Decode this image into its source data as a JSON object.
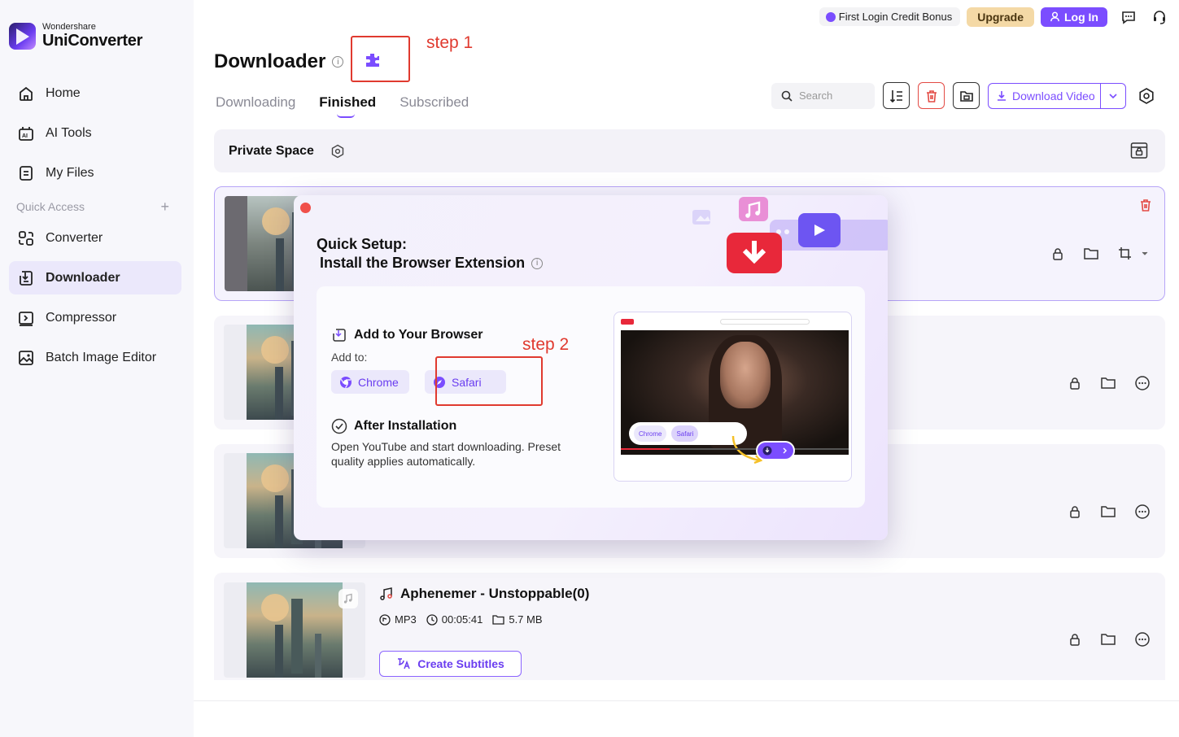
{
  "brand": {
    "line1": "Wondershare",
    "line2": "UniConverter"
  },
  "sidebar": {
    "items": [
      {
        "label": "Home",
        "icon": "home-icon"
      },
      {
        "label": "AI Tools",
        "icon": "ai-tools-icon"
      },
      {
        "label": "My Files",
        "icon": "my-files-icon"
      }
    ],
    "quick_access": {
      "label": "Quick Access",
      "add": "+"
    },
    "quick_items": [
      {
        "label": "Converter",
        "icon": "converter-icon"
      },
      {
        "label": "Downloader",
        "icon": "downloader-icon",
        "active": true
      },
      {
        "label": "Compressor",
        "icon": "compressor-icon"
      },
      {
        "label": "Batch Image Editor",
        "icon": "batch-image-editor-icon"
      }
    ]
  },
  "topbar": {
    "credit": "First Login Credit Bonus",
    "upgrade": "Upgrade",
    "login": "Log In"
  },
  "header": {
    "title": "Downloader",
    "info": "i",
    "tabs": [
      "Downloading",
      "Finished",
      "Subscribed"
    ],
    "active_tab": "Finished",
    "search_placeholder": "Search",
    "download_video": "Download Video"
  },
  "annotations": {
    "step1": "step 1",
    "step2": "step 2"
  },
  "private_space": {
    "label": "Private Space"
  },
  "songs": [
    {
      "title": "Aphenemer - Unstoppable(0)",
      "format": "MP3",
      "duration": "00:05:41",
      "size": "5.7 MB",
      "subtitles_button": "Create Subtitles"
    }
  ],
  "dialog": {
    "title_line1": "Quick Setup:",
    "title_line2": "Install the Browser Extension",
    "add_title": "Add to Your Browser",
    "add_to": "Add to:",
    "browsers": [
      "Chrome",
      "Safari"
    ],
    "after_title": "After Installation",
    "after_text": "Open YouTube and start downloading. Preset quality applies automatically.",
    "preview": {
      "chips": [
        "Chrome",
        "Safari"
      ]
    }
  },
  "colors": {
    "accent": "#7b4dff",
    "danger": "#e34a44",
    "annotation": "#e03a2f",
    "upgrade_bg": "#f4d9a6"
  }
}
